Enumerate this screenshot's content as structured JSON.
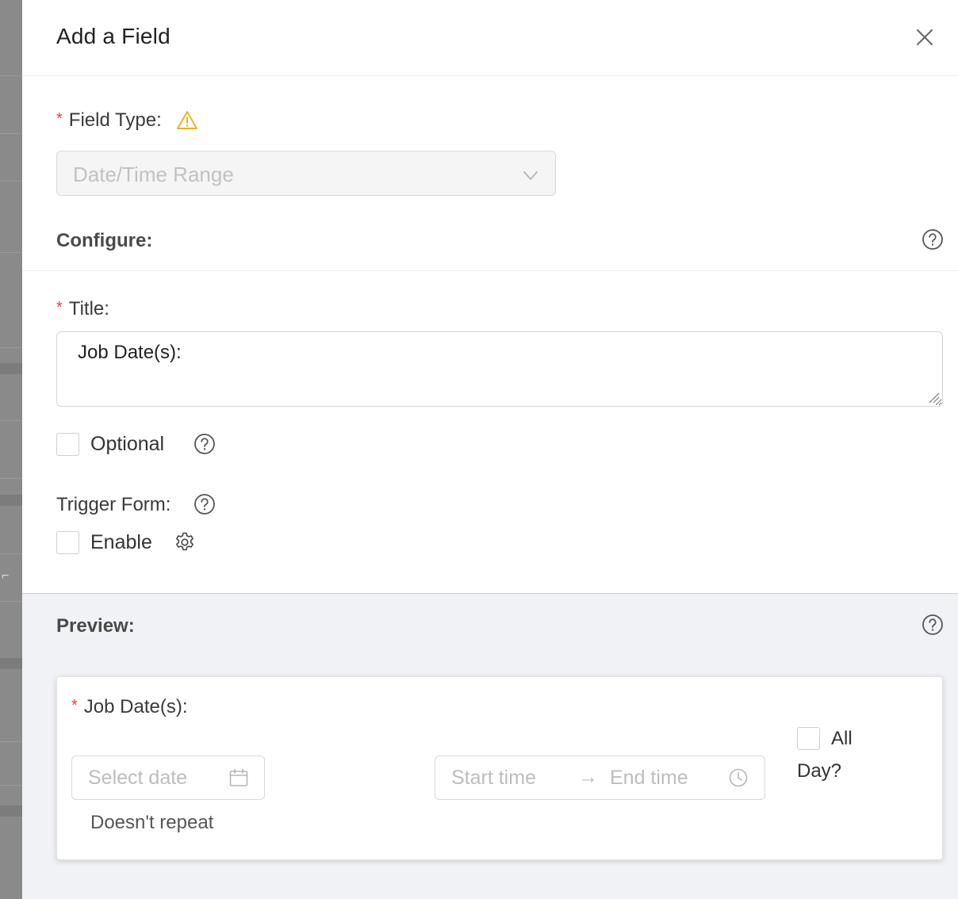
{
  "drawer": {
    "title": "Add a Field"
  },
  "field_type": {
    "label": "Field Type:",
    "required_mark": "*",
    "selected": "Date/Time Range"
  },
  "configure": {
    "title": "Configure:",
    "title_field": {
      "label": "Title:",
      "required_mark": "*",
      "value": "Job Date(s):"
    },
    "optional_label": "Optional",
    "trigger_form": {
      "label": "Trigger Form:",
      "enable_label": "Enable"
    }
  },
  "preview": {
    "title": "Preview:",
    "field_label": "Job Date(s):",
    "required_mark": "*",
    "date_placeholder": "Select date",
    "start_time_placeholder": "Start time",
    "range_arrow": "→",
    "end_time_placeholder": "End time",
    "all_day_line1": "All",
    "all_day_line2": "Day?",
    "repeat_text": "Doesn't repeat"
  },
  "colors": {
    "required": "#e0443a",
    "warning": "#e6b422",
    "preview_bg": "#f0f2f6"
  },
  "icons": [
    "close-icon",
    "warning-icon",
    "chevron-down-icon",
    "help-icon",
    "gear-icon",
    "calendar-icon",
    "clock-icon"
  ]
}
